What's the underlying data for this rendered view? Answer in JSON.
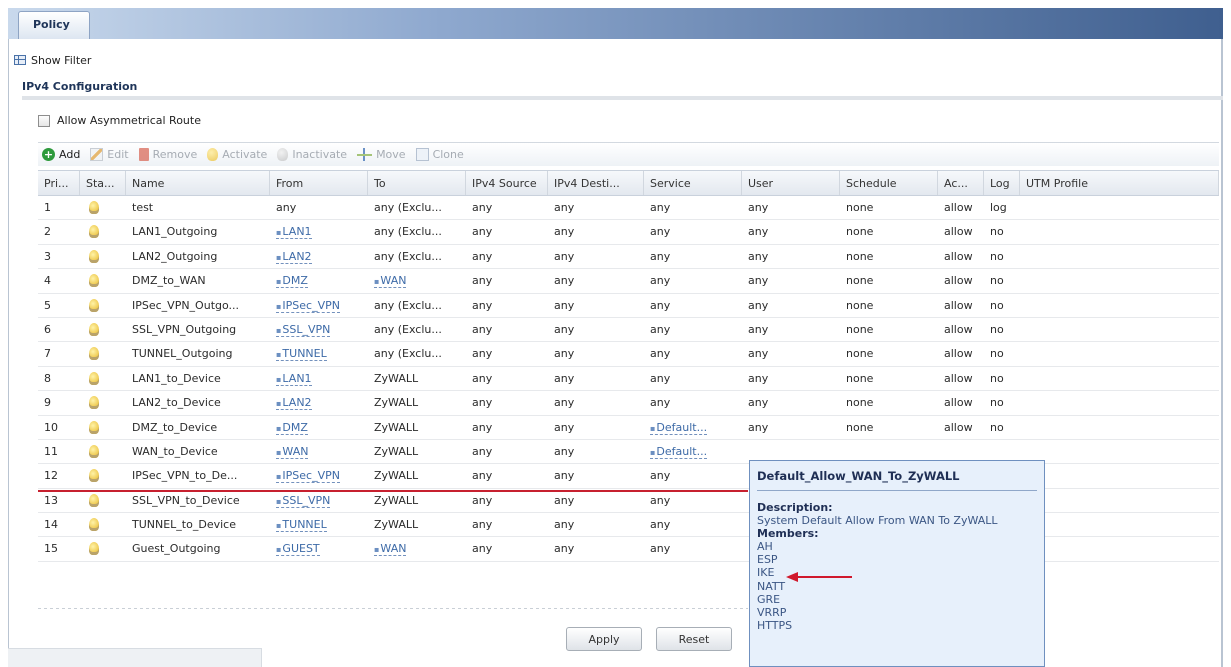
{
  "tab": {
    "label": "Policy"
  },
  "show_filter": {
    "label": "Show Filter"
  },
  "section": {
    "title": "IPv4 Configuration"
  },
  "options": {
    "asym_label": "Allow Asymmetrical Route",
    "asym_checked": false
  },
  "toolbar": {
    "add": "Add",
    "edit": "Edit",
    "remove": "Remove",
    "activate": "Activate",
    "inactivate": "Inactivate",
    "move": "Move",
    "clone": "Clone"
  },
  "table": {
    "headers": [
      "Pri...",
      "Sta...",
      "Name",
      "From",
      "To",
      "IPv4 Source",
      "IPv4 Desti...",
      "Service",
      "User",
      "Schedule",
      "Ac...",
      "Log",
      "UTM Profile"
    ],
    "rows": [
      {
        "pri": "1",
        "name": "test",
        "from": "any",
        "from_obj": false,
        "to": "any (Exclu...",
        "to_obj": false,
        "src": "any",
        "dst": "any",
        "service": "any",
        "service_obj": false,
        "user": "any",
        "schedule": "none",
        "action": "allow",
        "log": "log"
      },
      {
        "pri": "2",
        "name": "LAN1_Outgoing",
        "from": "LAN1",
        "from_obj": true,
        "to": "any (Exclu...",
        "to_obj": false,
        "src": "any",
        "dst": "any",
        "service": "any",
        "service_obj": false,
        "user": "any",
        "schedule": "none",
        "action": "allow",
        "log": "no"
      },
      {
        "pri": "3",
        "name": "LAN2_Outgoing",
        "from": "LAN2",
        "from_obj": true,
        "to": "any (Exclu...",
        "to_obj": false,
        "src": "any",
        "dst": "any",
        "service": "any",
        "service_obj": false,
        "user": "any",
        "schedule": "none",
        "action": "allow",
        "log": "no"
      },
      {
        "pri": "4",
        "name": "DMZ_to_WAN",
        "from": "DMZ",
        "from_obj": true,
        "to": "WAN",
        "to_obj": true,
        "src": "any",
        "dst": "any",
        "service": "any",
        "service_obj": false,
        "user": "any",
        "schedule": "none",
        "action": "allow",
        "log": "no"
      },
      {
        "pri": "5",
        "name": "IPSec_VPN_Outgo...",
        "from": "IPSec_VPN",
        "from_obj": true,
        "to": "any (Exclu...",
        "to_obj": false,
        "src": "any",
        "dst": "any",
        "service": "any",
        "service_obj": false,
        "user": "any",
        "schedule": "none",
        "action": "allow",
        "log": "no"
      },
      {
        "pri": "6",
        "name": "SSL_VPN_Outgoing",
        "from": "SSL_VPN",
        "from_obj": true,
        "to": "any (Exclu...",
        "to_obj": false,
        "src": "any",
        "dst": "any",
        "service": "any",
        "service_obj": false,
        "user": "any",
        "schedule": "none",
        "action": "allow",
        "log": "no"
      },
      {
        "pri": "7",
        "name": "TUNNEL_Outgoing",
        "from": "TUNNEL",
        "from_obj": true,
        "to": "any (Exclu...",
        "to_obj": false,
        "src": "any",
        "dst": "any",
        "service": "any",
        "service_obj": false,
        "user": "any",
        "schedule": "none",
        "action": "allow",
        "log": "no"
      },
      {
        "pri": "8",
        "name": "LAN1_to_Device",
        "from": "LAN1",
        "from_obj": true,
        "to": "ZyWALL",
        "to_obj": false,
        "src": "any",
        "dst": "any",
        "service": "any",
        "service_obj": false,
        "user": "any",
        "schedule": "none",
        "action": "allow",
        "log": "no"
      },
      {
        "pri": "9",
        "name": "LAN2_to_Device",
        "from": "LAN2",
        "from_obj": true,
        "to": "ZyWALL",
        "to_obj": false,
        "src": "any",
        "dst": "any",
        "service": "any",
        "service_obj": false,
        "user": "any",
        "schedule": "none",
        "action": "allow",
        "log": "no"
      },
      {
        "pri": "10",
        "name": "DMZ_to_Device",
        "from": "DMZ",
        "from_obj": true,
        "to": "ZyWALL",
        "to_obj": false,
        "src": "any",
        "dst": "any",
        "service": "Default...",
        "service_obj": true,
        "user": "any",
        "schedule": "none",
        "action": "allow",
        "log": "no"
      },
      {
        "pri": "11",
        "name": "WAN_to_Device",
        "from": "WAN",
        "from_obj": true,
        "to": "ZyWALL",
        "to_obj": false,
        "src": "any",
        "dst": "any",
        "service": "Default...",
        "service_obj": true,
        "user": "",
        "schedule": "",
        "action": "",
        "log": ""
      },
      {
        "pri": "12",
        "name": "IPSec_VPN_to_De...",
        "from": "IPSec_VPN",
        "from_obj": true,
        "to": "ZyWALL",
        "to_obj": false,
        "src": "any",
        "dst": "any",
        "service": "any",
        "service_obj": false,
        "user": "",
        "schedule": "",
        "action": "",
        "log": ""
      },
      {
        "pri": "13",
        "name": "SSL_VPN_to_Device",
        "from": "SSL_VPN",
        "from_obj": true,
        "to": "ZyWALL",
        "to_obj": false,
        "src": "any",
        "dst": "any",
        "service": "any",
        "service_obj": false,
        "user": "",
        "schedule": "",
        "action": "",
        "log": ""
      },
      {
        "pri": "14",
        "name": "TUNNEL_to_Device",
        "from": "TUNNEL",
        "from_obj": true,
        "to": "ZyWALL",
        "to_obj": false,
        "src": "any",
        "dst": "any",
        "service": "any",
        "service_obj": false,
        "user": "",
        "schedule": "",
        "action": "",
        "log": ""
      },
      {
        "pri": "15",
        "name": "Guest_Outgoing",
        "from": "GUEST",
        "from_obj": true,
        "to": "WAN",
        "to_obj": true,
        "src": "any",
        "dst": "any",
        "service": "any",
        "service_obj": false,
        "user": "",
        "schedule": "",
        "action": "",
        "log": ""
      }
    ]
  },
  "tooltip": {
    "title": "Default_Allow_WAN_To_ZyWALL",
    "description_label": "Description:",
    "description": "System Default Allow From WAN To ZyWALL",
    "members_label": "Members:",
    "members": [
      "AH",
      "ESP",
      "IKE",
      "NATT",
      "GRE",
      "VRRP",
      "HTTPS"
    ]
  },
  "buttons": {
    "apply": "Apply",
    "reset": "Reset"
  },
  "colors": {
    "highlight_line": "#c7202f",
    "arrow": "#d0182c",
    "link": "#3d6aa7"
  }
}
